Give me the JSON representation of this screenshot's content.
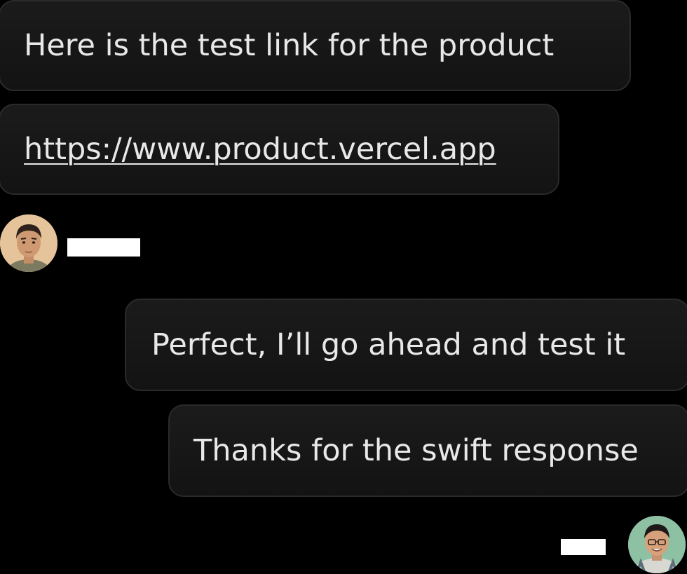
{
  "messages": {
    "incoming": [
      {
        "text": "Here is the test link for the product"
      },
      {
        "text": "https://www.product.vercel.app"
      }
    ],
    "outgoing": [
      {
        "text": "Perfect, I’ll go ahead and test it"
      },
      {
        "text": "Thanks for the swift response"
      }
    ]
  },
  "colors": {
    "background": "#000000",
    "bubble": "#161616",
    "bubble_border": "#2a2a2a",
    "text": "#e8e8e8"
  }
}
